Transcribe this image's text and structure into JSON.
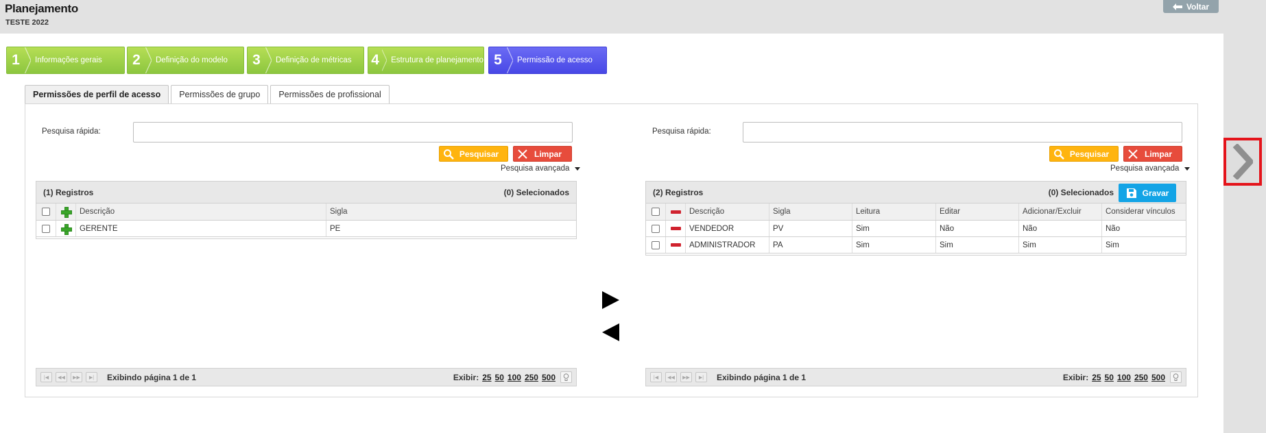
{
  "header": {
    "title": "Planejamento",
    "subtitle": "TESTE 2022",
    "back_label": "Voltar"
  },
  "steps": [
    {
      "num": "1",
      "label": "Informações gerais",
      "state": "done"
    },
    {
      "num": "2",
      "label": "Definição do modelo",
      "state": "done"
    },
    {
      "num": "3",
      "label": "Definição de métricas",
      "state": "done"
    },
    {
      "num": "4",
      "label": "Estrutura de planejamento",
      "state": "done"
    },
    {
      "num": "5",
      "label": "Permissão de acesso",
      "state": "active"
    }
  ],
  "tabs": [
    {
      "label": "Permissões de perfil de acesso",
      "active": true
    },
    {
      "label": "Permissões de grupo",
      "active": false
    },
    {
      "label": "Permissões de profissional",
      "active": false
    }
  ],
  "left": {
    "search_label": "Pesquisa rápida:",
    "search_value": "",
    "search_btn": "Pesquisar",
    "clear_btn": "Limpar",
    "advanced": "Pesquisa avançada",
    "records": "(1) Registros",
    "selected": "(0) Selecionados",
    "columns": [
      "Descrição",
      "Sigla"
    ],
    "rows": [
      {
        "descricao": "GERENTE",
        "sigla": "PE"
      }
    ],
    "pager": {
      "info": "Exibindo página 1 de 1",
      "show_label": "Exibir:",
      "sizes": [
        "25",
        "50",
        "100",
        "250",
        "500"
      ]
    }
  },
  "right": {
    "search_label": "Pesquisa rápida:",
    "search_value": "",
    "search_btn": "Pesquisar",
    "clear_btn": "Limpar",
    "advanced": "Pesquisa avançada",
    "records": "(2) Registros",
    "selected": "(0) Selecionados",
    "save_btn": "Gravar",
    "columns": [
      "Descrição",
      "Sigla",
      "Leitura",
      "Editar",
      "Adicionar/Excluir",
      "Considerar vínculos"
    ],
    "rows": [
      {
        "descricao": "VENDEDOR",
        "sigla": "PV",
        "leitura": "Sim",
        "editar": "Não",
        "adicionar": "Não",
        "considerar": "Não"
      },
      {
        "descricao": "ADMINISTRADOR",
        "sigla": "PA",
        "leitura": "Sim",
        "editar": "Sim",
        "adicionar": "Sim",
        "considerar": "Sim"
      }
    ],
    "pager": {
      "info": "Exibindo página 1 de 1",
      "show_label": "Exibir:",
      "sizes": [
        "25",
        "50",
        "100",
        "250",
        "500"
      ]
    }
  },
  "colors": {
    "step_done": "#8cc63f",
    "step_active": "#4848e6",
    "search_btn": "#ffb40f",
    "clear_btn": "#e74c3c",
    "save_btn": "#13a4e6",
    "next_highlight": "#e4141b"
  },
  "icons": {
    "back": "arrow-left-icon",
    "search": "magnifier-icon",
    "clear": "x-icon",
    "add": "plus-icon",
    "remove": "minus-icon",
    "save": "floppy-icon",
    "next": "chevron-right-icon",
    "bulb": "lightbulb-icon"
  }
}
